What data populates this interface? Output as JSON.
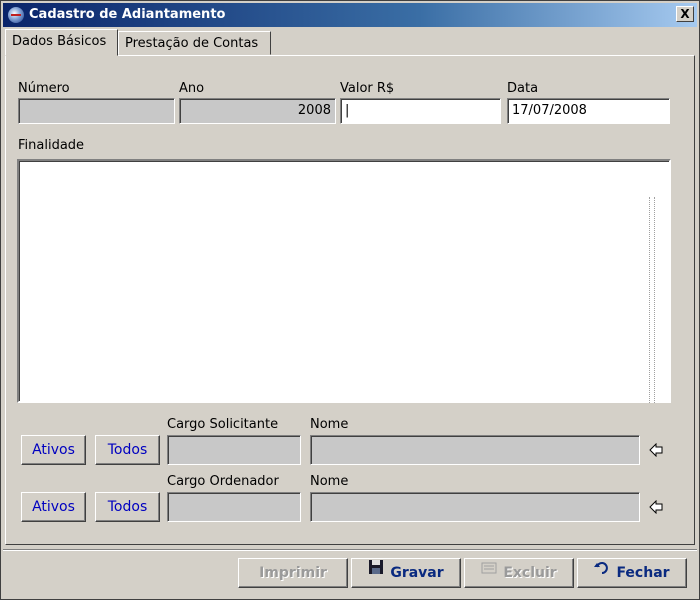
{
  "window": {
    "title": "Cadastro de Adiantamento",
    "close_label": "X"
  },
  "tabs": [
    {
      "label": "Dados Básicos",
      "active": true
    },
    {
      "label": "Prestação de Contas",
      "active": false
    }
  ],
  "form": {
    "numero_label": "Número",
    "numero_value": "",
    "ano_label": "Ano",
    "ano_value": "2008",
    "valor_label": "Valor R$",
    "valor_value": "|",
    "data_label": "Data",
    "data_value": "17/07/2008",
    "finalidade_label": "Finalidade",
    "finalidade_value": ""
  },
  "solicitante": {
    "ativos_label": "Ativos",
    "todos_label": "Todos",
    "cargo_label": "Cargo Solicitante",
    "nome_label": "Nome",
    "cargo_value": "",
    "nome_value": "",
    "arrow_icon": "arrow-left-icon"
  },
  "ordenador": {
    "ativos_label": "Ativos",
    "todos_label": "Todos",
    "cargo_label": "Cargo Ordenador",
    "nome_label": "Nome",
    "cargo_value": "",
    "nome_value": "",
    "arrow_icon": "arrow-left-icon"
  },
  "footer": {
    "imprimir_label": "Imprimir",
    "gravar_label": "Gravar",
    "excluir_label": "Excluir",
    "fechar_label": "Fechar"
  },
  "colors": {
    "titlebar_start": "#0a246a",
    "titlebar_end": "#a6caf0",
    "face": "#d4d0c8",
    "link_text": "#0000c0"
  }
}
